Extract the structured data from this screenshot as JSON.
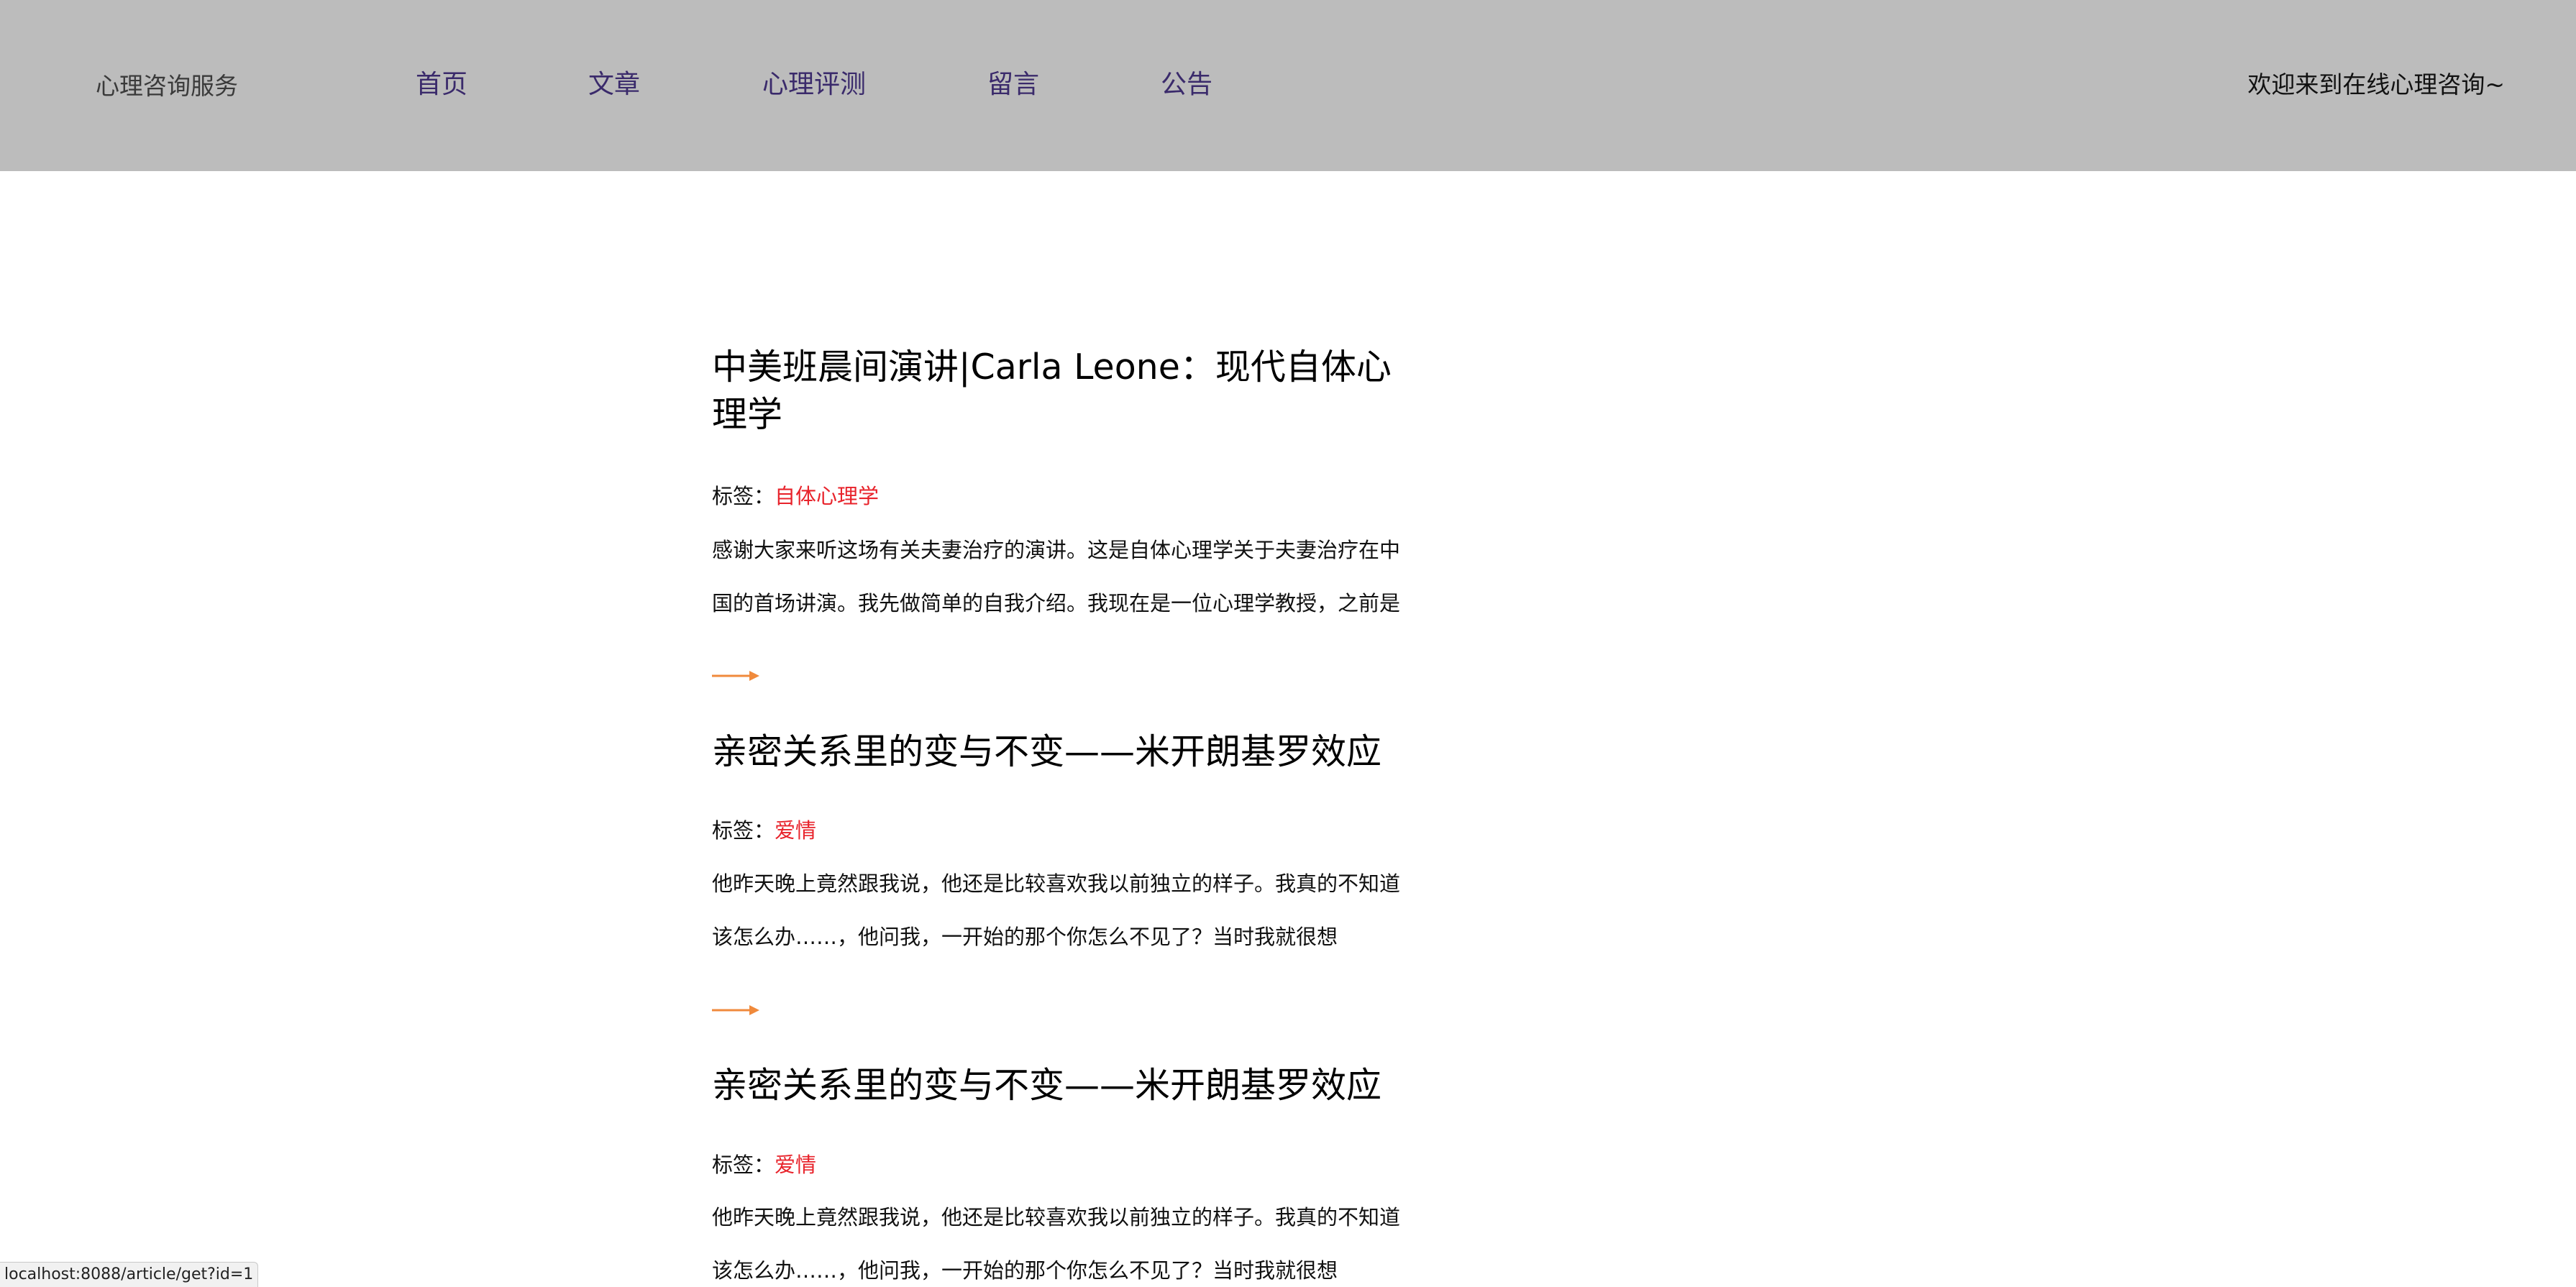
{
  "header": {
    "brand": "心理咨询服务",
    "nav": [
      {
        "label": "首页"
      },
      {
        "label": "文章"
      },
      {
        "label": "心理评测"
      },
      {
        "label": "留言"
      },
      {
        "label": "公告"
      }
    ],
    "welcome": "欢迎来到在线心理咨询~"
  },
  "articles": [
    {
      "title": "中美班晨间演讲|Carla Leone：现代自体心理学",
      "tag_label": "标签：",
      "tag": "自体心理学",
      "excerpt": "感谢大家来听这场有关夫妻治疗的演讲。这是自体心理学关于夫妻治疗在中国的首场讲演。我先做简单的自我介绍。我现在是一位心理学教授，之前是高..."
    },
    {
      "title": "亲密关系里的变与不变——米开朗基罗效应",
      "tag_label": "标签：",
      "tag": "爱情",
      "excerpt": "他昨天晚上竟然跟我说，他还是比较喜欢我以前独立的样子。我真的不知道该怎么办……，他问我，一开始的那个你怎么不见了？当时我就很想说：“当初..."
    },
    {
      "title": "亲密关系里的变与不变——米开朗基罗效应",
      "tag_label": "标签：",
      "tag": "爱情",
      "excerpt": "他昨天晚上竟然跟我说，他还是比较喜欢我以前独立的样子。我真的不知道该怎么办……，他问我，一开始的那个你怎么不见了？当时我就很想说：“当初..."
    }
  ],
  "arrow_icon": "right-arrow-icon",
  "colors": {
    "header_bg": "#bcbcbc",
    "nav_text": "#3a2a6b",
    "tag": "#e8232b",
    "arrow": "#f08a3c"
  },
  "status_bar": {
    "url": "localhost:8088/article/get?id=1"
  }
}
